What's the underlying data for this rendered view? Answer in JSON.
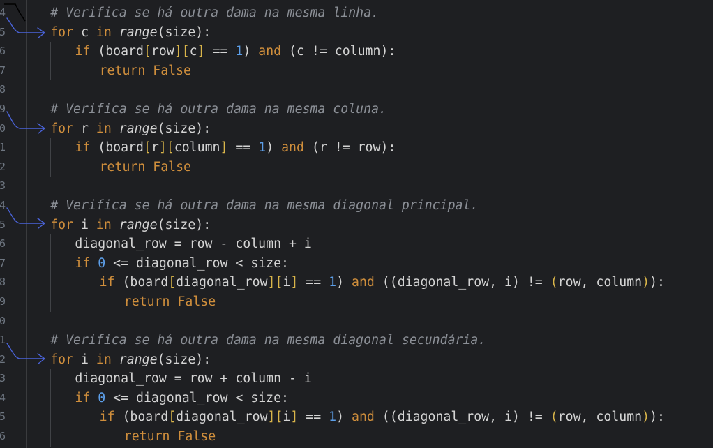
{
  "colors": {
    "background": "#1e1f22",
    "keyword": "#cf8e3c",
    "comment": "#8b8f96",
    "number": "#5c9ee8",
    "text": "#d4d4d4",
    "bracket": "#d9b54a",
    "annotation": "#4a63d9"
  },
  "lines": [
    {
      "n": "4",
      "indent": 1,
      "tokens": [
        [
          "cm",
          "# Verifica se há outra dama na mesma linha."
        ]
      ]
    },
    {
      "n": "5",
      "indent": 1,
      "tokens": [
        [
          "kw",
          "for"
        ],
        [
          "t",
          " c "
        ],
        [
          "kw",
          "in"
        ],
        [
          "t",
          " "
        ],
        [
          "fn",
          "range"
        ],
        [
          "t",
          "(size):"
        ]
      ]
    },
    {
      "n": "6",
      "indent": 2,
      "tokens": [
        [
          "kw",
          "if"
        ],
        [
          "t",
          " (board"
        ],
        [
          "br",
          "["
        ],
        [
          "t",
          "row"
        ],
        [
          "br",
          "]"
        ],
        [
          "br",
          "["
        ],
        [
          "t",
          "c"
        ],
        [
          "br",
          "]"
        ],
        [
          "t",
          " == "
        ],
        [
          "num",
          "1"
        ],
        [
          "t",
          ") "
        ],
        [
          "kw",
          "and"
        ],
        [
          "t",
          " (c != column):"
        ]
      ]
    },
    {
      "n": "7",
      "indent": 3,
      "tokens": [
        [
          "kw",
          "return"
        ],
        [
          "t",
          " "
        ],
        [
          "kw",
          "False"
        ]
      ]
    },
    {
      "n": "8",
      "indent": 0,
      "tokens": []
    },
    {
      "n": "9",
      "indent": 1,
      "tokens": [
        [
          "cm",
          "# Verifica se há outra dama na mesma coluna."
        ]
      ]
    },
    {
      "n": "0",
      "indent": 1,
      "tokens": [
        [
          "kw",
          "for"
        ],
        [
          "t",
          " r "
        ],
        [
          "kw",
          "in"
        ],
        [
          "t",
          " "
        ],
        [
          "fn",
          "range"
        ],
        [
          "t",
          "(size):"
        ]
      ]
    },
    {
      "n": "1",
      "indent": 2,
      "tokens": [
        [
          "kw",
          "if"
        ],
        [
          "t",
          " (board"
        ],
        [
          "br",
          "["
        ],
        [
          "t",
          "r"
        ],
        [
          "br",
          "]"
        ],
        [
          "br",
          "["
        ],
        [
          "t",
          "column"
        ],
        [
          "br",
          "]"
        ],
        [
          "t",
          " == "
        ],
        [
          "num",
          "1"
        ],
        [
          "t",
          ") "
        ],
        [
          "kw",
          "and"
        ],
        [
          "t",
          " (r != row):"
        ]
      ]
    },
    {
      "n": "2",
      "indent": 3,
      "tokens": [
        [
          "kw",
          "return"
        ],
        [
          "t",
          " "
        ],
        [
          "kw",
          "False"
        ]
      ]
    },
    {
      "n": "3",
      "indent": 0,
      "tokens": []
    },
    {
      "n": "4",
      "indent": 1,
      "tokens": [
        [
          "cm",
          "# Verifica se há outra dama na mesma diagonal principal."
        ]
      ]
    },
    {
      "n": "5",
      "indent": 1,
      "tokens": [
        [
          "kw",
          "for"
        ],
        [
          "t",
          " i "
        ],
        [
          "kw",
          "in"
        ],
        [
          "t",
          " "
        ],
        [
          "fn",
          "range"
        ],
        [
          "t",
          "(size):"
        ]
      ]
    },
    {
      "n": "6",
      "indent": 2,
      "tokens": [
        [
          "t",
          "diagonal_row = row - column + i"
        ]
      ]
    },
    {
      "n": "7",
      "indent": 2,
      "tokens": [
        [
          "kw",
          "if"
        ],
        [
          "t",
          " "
        ],
        [
          "num",
          "0"
        ],
        [
          "t",
          " <= diagonal_row < size:"
        ]
      ]
    },
    {
      "n": "8",
      "indent": 3,
      "tokens": [
        [
          "kw",
          "if"
        ],
        [
          "t",
          " (board"
        ],
        [
          "br",
          "["
        ],
        [
          "t",
          "diagonal_row"
        ],
        [
          "br",
          "]"
        ],
        [
          "br",
          "["
        ],
        [
          "t",
          "i"
        ],
        [
          "br",
          "]"
        ],
        [
          "t",
          " == "
        ],
        [
          "num",
          "1"
        ],
        [
          "t",
          ") "
        ],
        [
          "kw",
          "and"
        ],
        [
          "t",
          " ((diagonal_row, i) != "
        ],
        [
          "br",
          "("
        ],
        [
          "t",
          "row, column"
        ],
        [
          "br",
          ")"
        ],
        [
          "t",
          "):"
        ]
      ]
    },
    {
      "n": "9",
      "indent": 4,
      "tokens": [
        [
          "kw",
          "return"
        ],
        [
          "t",
          " "
        ],
        [
          "kw",
          "False"
        ]
      ]
    },
    {
      "n": "0",
      "indent": 0,
      "tokens": []
    },
    {
      "n": "1",
      "indent": 1,
      "tokens": [
        [
          "cm",
          "# Verifica se há outra dama na mesma diagonal secundária."
        ]
      ]
    },
    {
      "n": "2",
      "indent": 1,
      "tokens": [
        [
          "kw",
          "for"
        ],
        [
          "t",
          " i "
        ],
        [
          "kw",
          "in"
        ],
        [
          "t",
          " "
        ],
        [
          "fn",
          "range"
        ],
        [
          "t",
          "(size):"
        ]
      ]
    },
    {
      "n": "3",
      "indent": 2,
      "tokens": [
        [
          "t",
          "diagonal_row = row + column - i"
        ]
      ]
    },
    {
      "n": "4",
      "indent": 2,
      "tokens": [
        [
          "kw",
          "if"
        ],
        [
          "t",
          " "
        ],
        [
          "num",
          "0"
        ],
        [
          "t",
          " <= diagonal_row < size:"
        ]
      ]
    },
    {
      "n": "5",
      "indent": 3,
      "tokens": [
        [
          "kw",
          "if"
        ],
        [
          "t",
          " (board"
        ],
        [
          "br",
          "["
        ],
        [
          "t",
          "diagonal_row"
        ],
        [
          "br",
          "]"
        ],
        [
          "br",
          "["
        ],
        [
          "t",
          "i"
        ],
        [
          "br",
          "]"
        ],
        [
          "t",
          " == "
        ],
        [
          "num",
          "1"
        ],
        [
          "t",
          ") "
        ],
        [
          "kw",
          "and"
        ],
        [
          "t",
          " ((diagonal_row, i) != "
        ],
        [
          "br",
          "("
        ],
        [
          "t",
          "row, column"
        ],
        [
          "br",
          ")"
        ],
        [
          "t",
          "):"
        ]
      ]
    },
    {
      "n": "6",
      "indent": 4,
      "tokens": [
        [
          "kw",
          "return"
        ],
        [
          "t",
          " "
        ],
        [
          "kw",
          "False"
        ]
      ]
    }
  ]
}
